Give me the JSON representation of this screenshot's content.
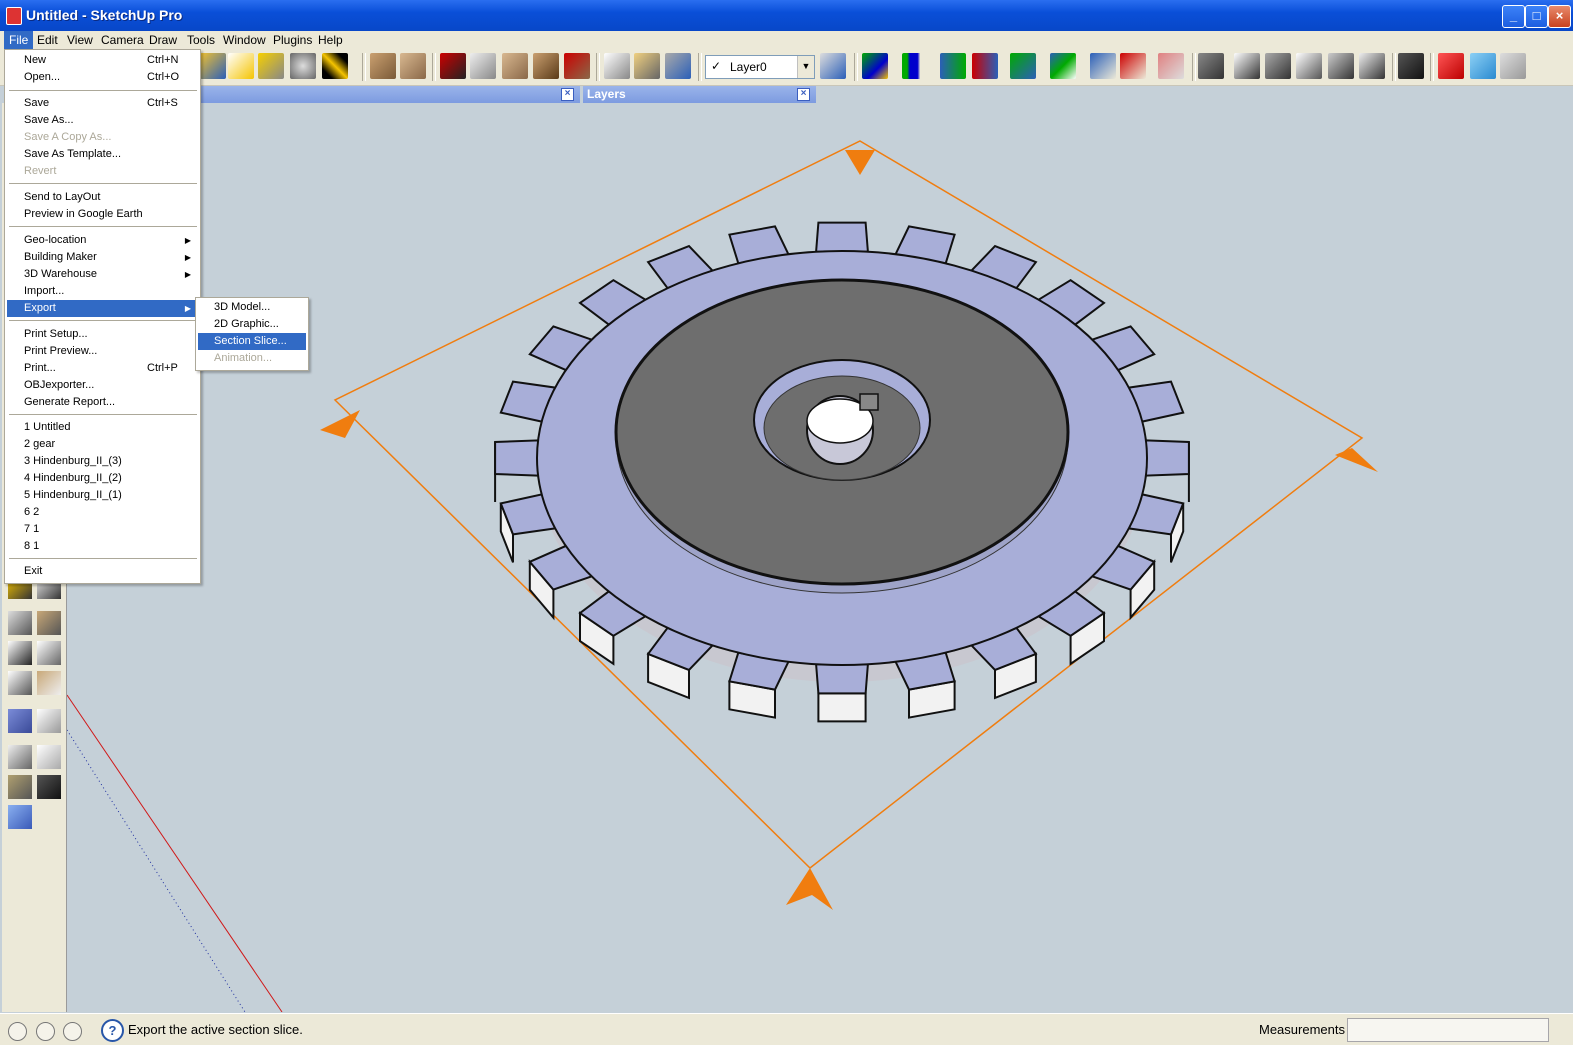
{
  "window": {
    "title": "Untitled - SketchUp Pro",
    "min": "_",
    "max": "□",
    "close": "×"
  },
  "menubar": [
    "File",
    "Edit",
    "View",
    "Camera",
    "Draw",
    "Tools",
    "Window",
    "Plugins",
    "Help"
  ],
  "layer_select": {
    "check": "✓",
    "value": "Layer0",
    "arrow": "▼"
  },
  "panels": {
    "first_close": "×",
    "layers_title": "Layers",
    "layers_close": "×"
  },
  "file_menu": {
    "new": "New",
    "new_sc": "Ctrl+N",
    "open": "Open...",
    "open_sc": "Ctrl+O",
    "save": "Save",
    "save_sc": "Ctrl+S",
    "save_as": "Save As...",
    "save_copy_as": "Save A Copy As...",
    "save_as_template": "Save As Template...",
    "revert": "Revert",
    "send_to_layout": "Send to LayOut",
    "preview_google_earth": "Preview in Google Earth",
    "geo_location": "Geo-location",
    "building_maker": "Building Maker",
    "warehouse": "3D Warehouse",
    "import": "Import...",
    "export": "Export",
    "print_setup": "Print Setup...",
    "print_preview": "Print Preview...",
    "print": "Print...",
    "print_sc": "Ctrl+P",
    "objexporter": "OBJexporter...",
    "generate_report": "Generate Report...",
    "recent": [
      "1 Untitled",
      "2 gear",
      "3 Hindenburg_II_(3)",
      "4 Hindenburg_II_(2)",
      "5 Hindenburg_II_(1)",
      "6 2",
      "7 1",
      "8 1"
    ],
    "exit": "Exit",
    "arrow": "▶"
  },
  "export_menu": {
    "model": "3D Model...",
    "graphic": "2D Graphic...",
    "section": "Section Slice...",
    "animation": "Animation..."
  },
  "status": {
    "help": "?",
    "text": "Export the active section slice.",
    "measurements": "Measurements",
    "measurements_value": ""
  },
  "colors": {
    "section_plane": "#f07d0f",
    "gear_face": "#6e6e6e",
    "gear_side": "#a8aed8",
    "selection": "#316ac5"
  }
}
